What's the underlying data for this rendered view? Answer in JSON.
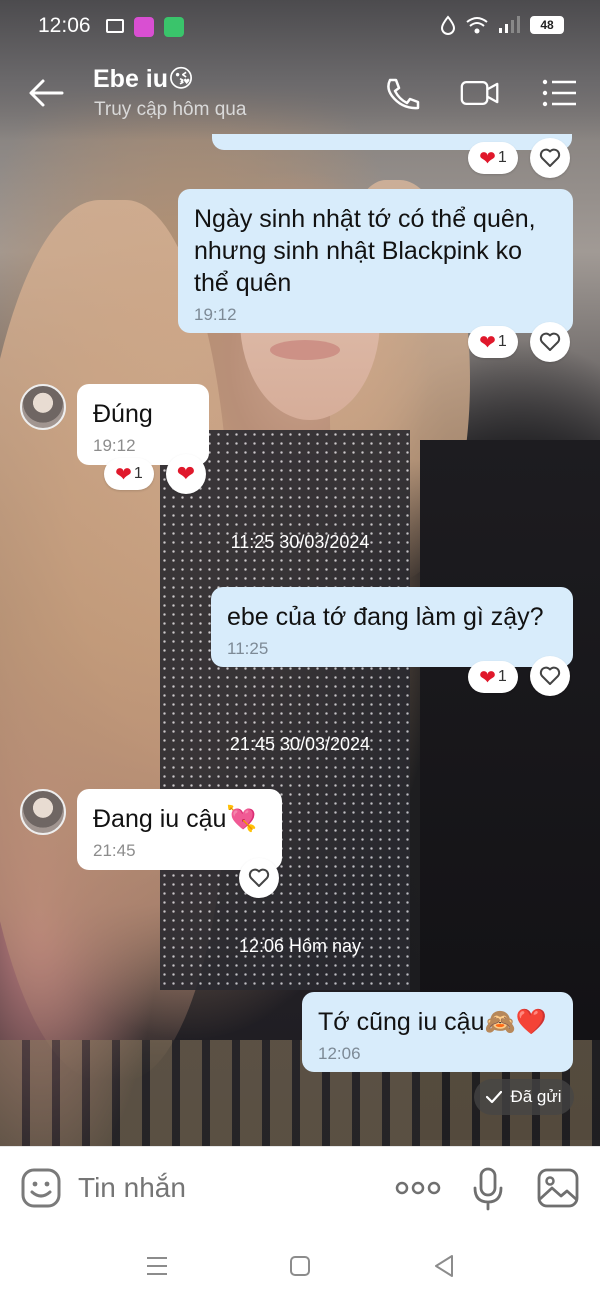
{
  "status_bar": {
    "time": "12:06",
    "battery": "48"
  },
  "header": {
    "contact_name": "Ebe iu😘",
    "contact_status": "Truy cập hôm qua"
  },
  "messages": [
    {
      "direction": "out",
      "text": "Ngày sinh nhật tớ có thể quên, nhưng sinh nhật Blackpink ko thể quên",
      "time": "19:12",
      "reaction_count": "1"
    },
    {
      "direction": "in",
      "text": "Đúng",
      "time": "19:12",
      "reaction_count": "1"
    },
    {
      "direction": "out",
      "text": "ebe của tớ đang làm gì zậy?",
      "time": "11:25",
      "reaction_count": "1"
    },
    {
      "direction": "in",
      "text": "Đang iu cậu💘",
      "time": "21:45"
    },
    {
      "direction": "out",
      "text": "Tớ cũng iu cậu🙈❤️",
      "time": "12:06"
    }
  ],
  "top_reaction_count": "1",
  "date_separators": [
    "11:25 30/03/2024",
    "21:45 30/03/2024",
    "12:06 Hôm nay"
  ],
  "sent_status": "Đã gửi",
  "input": {
    "placeholder": "Tin nhắn"
  },
  "colors": {
    "outgoing_bubble": "#d8ecfb",
    "incoming_bubble": "#ffffff",
    "heart": "#e0182b"
  }
}
